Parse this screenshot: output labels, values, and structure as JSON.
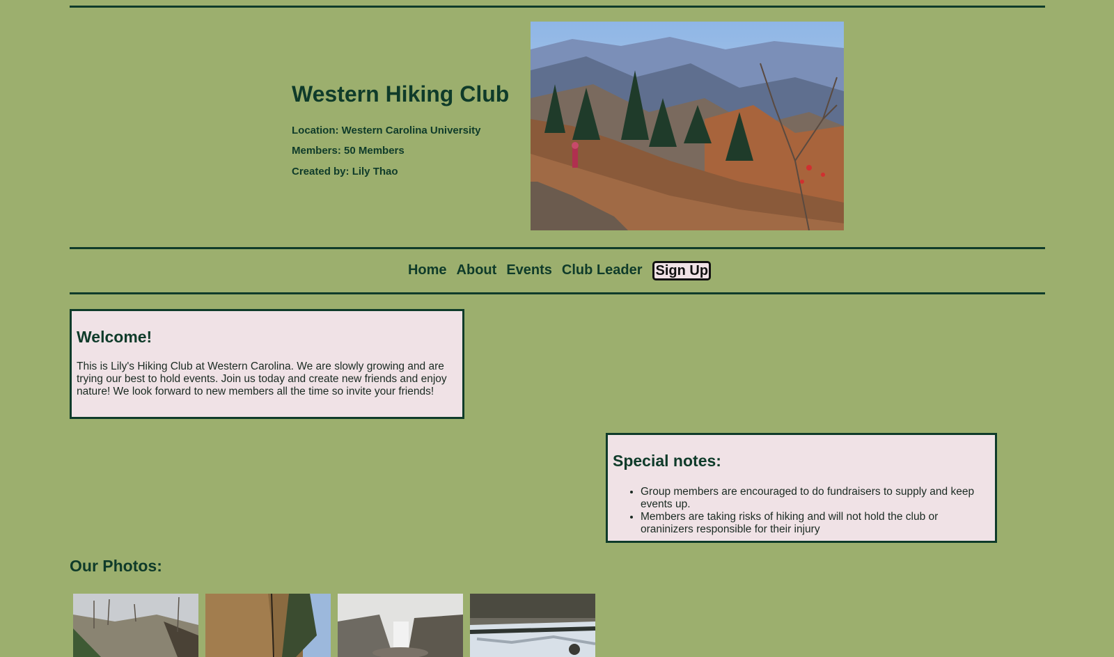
{
  "header": {
    "title": "Western Hiking Club",
    "location": "Location: Western Carolina University",
    "members": "Members: 50 Members",
    "created_by": "Created by: Lily Thao"
  },
  "nav": {
    "items": [
      "Home",
      "About",
      "Events",
      "Club Leader"
    ],
    "signup": "Sign Up"
  },
  "welcome": {
    "heading": "Welcome!",
    "body": "This is Lily's Hiking Club at Western Carolina. We are slowly growing and are trying our best to hold events. Join us today and create new friends and enjoy nature! We look forward to new members all the time so invite your friends!"
  },
  "notes": {
    "heading": "Special notes:",
    "items": [
      "Group members are encouraged to do fundraisers to supply and keep events up.",
      "Members are taking risks of hiking and will not hold the club or oraninizers responsible for their injury"
    ]
  },
  "photos": {
    "heading": "Our Photos:"
  },
  "colors": {
    "background": "#9caf6e",
    "text": "#0f3b2a",
    "card": "#f0e2e6"
  }
}
